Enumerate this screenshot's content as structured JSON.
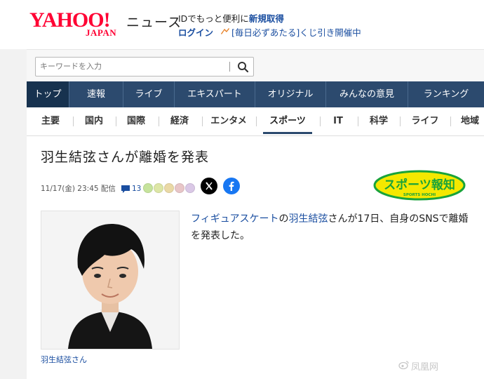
{
  "header": {
    "logo_text": "YAHOO!",
    "logo_sub": "JAPAN",
    "service_name": "ニュース",
    "promo_prefix": "IDでもっと便利に",
    "promo_signup": "新規取得",
    "login_label": "ログイン",
    "lottery_text": "[毎日必ずあたる]くじ引き開催中"
  },
  "search": {
    "placeholder": "キーワードを入力"
  },
  "nav": {
    "items": [
      "トップ",
      "速報",
      "ライブ",
      "エキスパート",
      "オリジナル",
      "みんなの意見",
      "ランキング"
    ],
    "active": "トップ"
  },
  "subnav": {
    "items": [
      "主要",
      "国内",
      "国際",
      "経済",
      "エンタメ",
      "スポーツ",
      "IT",
      "科学",
      "ライフ",
      "地域"
    ],
    "active": "スポーツ"
  },
  "article": {
    "title": "羽生結弦さんが離婚を発表",
    "date": "11/17(金) 23:45 配信",
    "comment_count": "13",
    "sponsor": "スポーツ報知",
    "sponsor_sub": "SPORTS HOCHI",
    "photo_caption": "羽生結弦さん",
    "body": {
      "link1": "フィギュアスケート",
      "text1": "の",
      "link2": "羽生結弦",
      "text2": "さんが17日、自身のSNSで離婚を発表した。"
    }
  },
  "watermark": "凤凰网",
  "colors": {
    "yahoo_red": "#ff0033",
    "nav_bg": "#2c4a6e",
    "link_blue": "#1a4ea0",
    "sponsor_yellow": "#f4e800",
    "sponsor_green": "#19a33a"
  }
}
